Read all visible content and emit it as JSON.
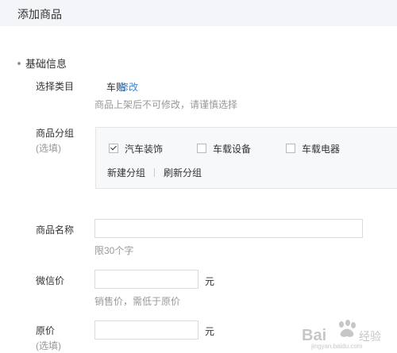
{
  "header": {
    "title": "添加商品"
  },
  "section": {
    "title": "基础信息"
  },
  "category": {
    "label": "选择类目",
    "value": "车贴",
    "edit_link": "修改",
    "hint": "商品上架后不可修改，请谨慎选择"
  },
  "group": {
    "label": "商品分组",
    "optional": "(选填)",
    "options": [
      {
        "label": "汽车装饰",
        "checked": true
      },
      {
        "label": "车载设备",
        "checked": false
      },
      {
        "label": "车载电器",
        "checked": false
      }
    ],
    "new_group": "新建分组",
    "refresh_group": "刷新分组"
  },
  "name": {
    "label": "商品名称",
    "value": "",
    "hint": "限30个字"
  },
  "wechat_price": {
    "label": "微信价",
    "value": "",
    "unit": "元",
    "hint": "销售价，需低于原价"
  },
  "original_price": {
    "label": "原价",
    "optional": "(选填)",
    "value": "",
    "unit": "元"
  },
  "watermark": {
    "text": "Baidu经验",
    "url": "jingyan.baidu.com"
  }
}
